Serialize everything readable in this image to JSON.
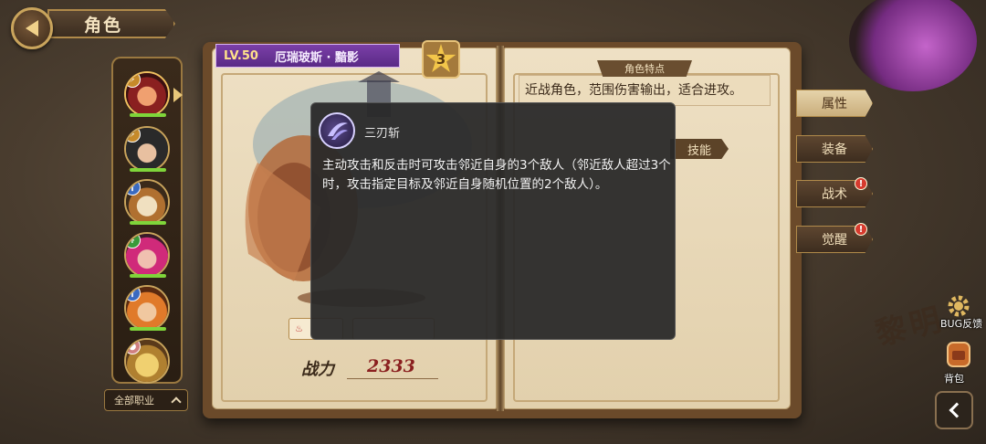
{
  "header": {
    "title": "角色"
  },
  "character": {
    "level": "LV.50",
    "name": "厄瑞玻斯 · 黯影",
    "stars": "3",
    "power_label": "战力",
    "power_value": "2333",
    "feature_title": "角色特点",
    "feature_text": "近战角色，范围伤害输出，适合进攻。",
    "skill_tab": "技能"
  },
  "char_list": {
    "filter_label": "全部职业"
  },
  "tabs": [
    {
      "label": "属性",
      "active": true,
      "alert": false
    },
    {
      "label": "装备",
      "active": false,
      "alert": false
    },
    {
      "label": "战术",
      "active": false,
      "alert": true
    },
    {
      "label": "觉醒",
      "active": false,
      "alert": true
    }
  ],
  "side": {
    "bug_label": "BUG反馈",
    "bag_label": "背包"
  },
  "background": {
    "text": "黎明"
  },
  "tooltip": {
    "skill_name": "三刃斩",
    "description": "主动攻击和反击时可攻击邻近自身的3个敌人（邻近敌人超过3个时，攻击指定目标及邻近自身随机位置的2个敌人）。"
  },
  "colors": {
    "level_banner": "#6b34a0",
    "power_value": "#8a1f1f",
    "alert": "#d63a2e",
    "hp_bar": "#7fd53a"
  }
}
